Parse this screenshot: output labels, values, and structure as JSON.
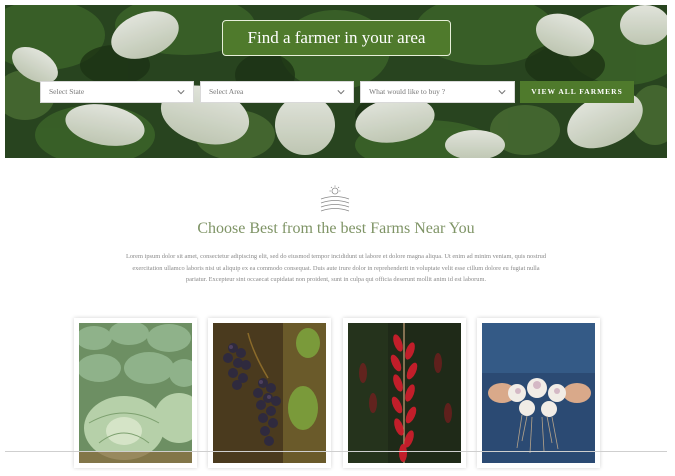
{
  "hero": {
    "title": "Find a farmer in your area",
    "filters": {
      "state_placeholder": "Select State",
      "area_placeholder": "Select Area",
      "product_placeholder": "What would like to buy ?"
    },
    "button_label": "VIEW ALL FARMERS"
  },
  "section": {
    "icon": "farm-field-sun-icon",
    "title": "Choose Best from the best Farms Near You",
    "body": "Lorem ipsum dolor sit amet, consectetur adipiscing elit, sed do eiusmod tempor incididunt ut labore et dolore magna aliqua. Ut enim ad minim veniam, quis nostrud exercitation ullamco laboris nisi ut aliquip ex ea commodo consequat. Duis aute irure dolor in reprehenderit in voluptate velit esse cillum dolore eu fugiat nulla pariatur. Excepteur sint occaecat cupidatat non proident, sunt in culpa qui officia deserunt mollit anim id est laborum."
  },
  "cards": [
    {
      "image": "cabbage-field"
    },
    {
      "image": "grape-cluster"
    },
    {
      "image": "red-chili-peppers"
    },
    {
      "image": "hands-holding-garlic"
    }
  ],
  "colors": {
    "brand_green": "#4f7a2c",
    "title_green": "#7f9466",
    "body_text": "#8a8a8a"
  }
}
